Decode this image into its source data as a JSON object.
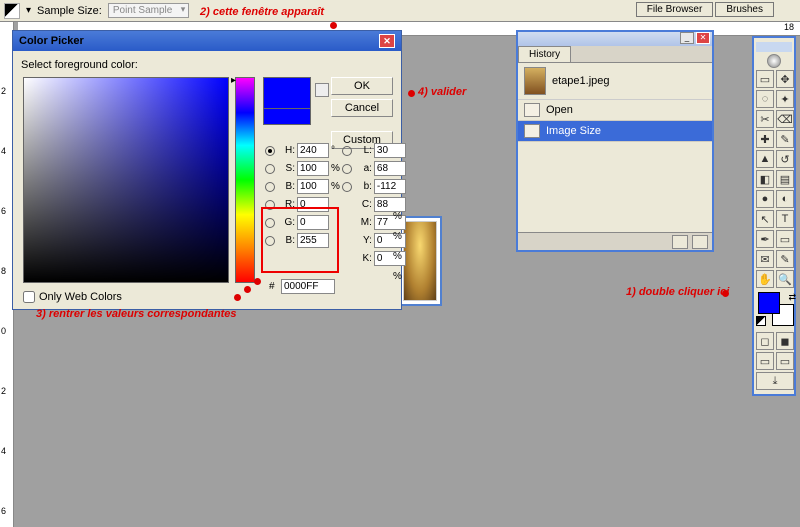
{
  "top": {
    "sample_label": "Sample Size:",
    "sample_value": "Point Sample",
    "file_browser": "File Browser",
    "brushes": "Brushes",
    "ruler_right": "18"
  },
  "ruler_left": [
    "2",
    "4",
    "6",
    "8",
    "0",
    "2",
    "4",
    "6"
  ],
  "ann": {
    "a1": "1) double cliquer ici",
    "a2": "2) cette fenêtre apparaît",
    "a3": "3) rentrer les valeurs correspondantes",
    "a4": "4) valider"
  },
  "cp": {
    "title": "Color Picker",
    "label": "Select foreground color:",
    "ok": "OK",
    "cancel": "Cancel",
    "custom": "Custom",
    "H": "240",
    "S": "100",
    "B": "100",
    "R": "0",
    "G": "0",
    "Bb": "255",
    "L": "30",
    "a": "68",
    "b": "-112",
    "C": "88",
    "M": "77",
    "Y": "0",
    "K": "0",
    "hex": "0000FF",
    "owc": "Only Web Colors",
    "lbl": {
      "H": "H:",
      "S": "S:",
      "B": "B:",
      "R": "R:",
      "G": "G:",
      "Bb": "B:",
      "L": "L:",
      "a": "a:",
      "b": "b:",
      "C": "C:",
      "M": "M:",
      "Y": "Y:",
      "K": "K:"
    },
    "deg": "°",
    "pct": "%"
  },
  "hist": {
    "tab": "History",
    "file": "etape1.jpeg",
    "open": "Open",
    "imgsize": "Image Size"
  },
  "tools": {
    "icons": [
      "▭",
      "↖",
      "◌",
      "✂",
      "✎",
      "⌫",
      "✏",
      "◧",
      "⬚",
      "▤",
      "◐",
      "⟋",
      "A",
      "T",
      "◻",
      "✥",
      "✦",
      "◔",
      "✋",
      "🔍",
      "⊕",
      "⊖"
    ]
  }
}
